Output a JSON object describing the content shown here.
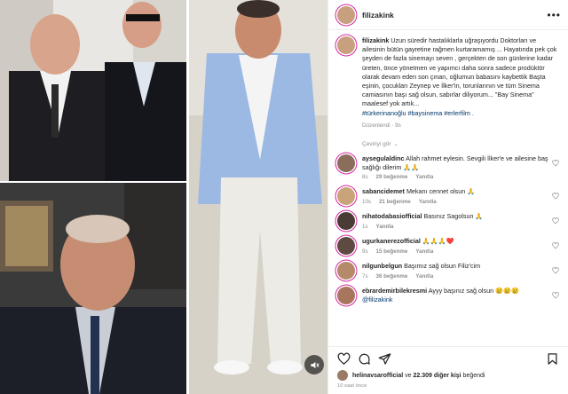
{
  "post": {
    "username": "filizakink",
    "caption_user": "filizakink",
    "caption": "Uzun süredir hastalıklarla uğraşıyordu Doktorları ve ailesinin bütün gayretine rağmen kurtaramamış ... Hayatında pek çok şeyden de fazla sinemayı seven , gerçekten de son günlerine kadar üreten, önce yönetmen ve yapımcı daha sonra sadece prodüktör olarak devam eden son çınarı, oğlumun babasını kaybettik Başta eşinin, çocukları Zeynep ve İlker'in, torunlarının ve tüm Sinema camiasının başı sağ olsun, sabırlar diliyorum... \"Bay Sinema\" maalesef yok artık...",
    "hashtags": "#türkerinanoğlu #baysinema #erlerfilm .",
    "edited": "Düzenlendi · 9s",
    "translate": "Çeviriyi gör"
  },
  "comments": [
    {
      "user": "aysegulaldinc",
      "text": "Allah rahmet eylesin. Sevgili İlker'e ve ailesine baş sağlığı dilerim 🙏🙏",
      "time": "8s",
      "likes": "29 beğenme",
      "reply": "Yanıtla",
      "color": "#8a6d5a"
    },
    {
      "user": "sabancidemet",
      "text": "Mekanı cennet olsun 🙏",
      "time": "10s",
      "likes": "21 beğenme",
      "reply": "Yanıtla",
      "color": "#c9a37a"
    },
    {
      "user": "nihatodabasiofficial",
      "text": "Basınız Sagolsun 🙏",
      "time": "1s",
      "likes": "",
      "reply": "Yanıtla",
      "color": "#4b3b36"
    },
    {
      "user": "ugurkanerezofficial",
      "text": "🙏🙏🙏❤️",
      "time": "9s",
      "likes": "15 beğenme",
      "reply": "Yanıtla",
      "color": "#5e4a40"
    },
    {
      "user": "nilgunbelgun",
      "text": "Başımız sağ olsun Filiz'cim",
      "time": "7s",
      "likes": "36 beğenme",
      "reply": "Yanıtla",
      "color": "#b48a6a"
    },
    {
      "user": "ebrardemirbilekresmi",
      "text": "Ayyy başınız sağ olsun 😢😢😢",
      "mention": "@filizakink",
      "time": "",
      "likes": "",
      "reply": "",
      "color": "#a8765e"
    }
  ],
  "likes": {
    "user": "helinavsarofficial",
    "connector": "ve",
    "count": "22.309 diğer kişi",
    "suffix": "beğendi"
  },
  "posted_ago": "10 saat önce",
  "colors": {
    "link": "#00376b",
    "meta": "#8e8e8e",
    "ring": "#d6249f"
  },
  "icons": [
    "more-icon",
    "heart-icon",
    "comment-icon",
    "share-icon",
    "save-icon",
    "mute-icon"
  ]
}
